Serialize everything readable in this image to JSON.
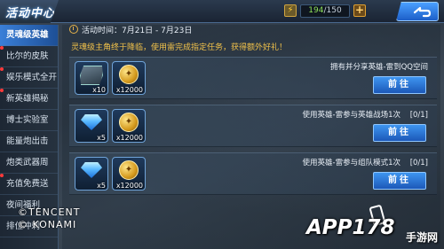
{
  "header": {
    "title": "活动中心",
    "stamina_current": "194",
    "stamina_max": "/150",
    "plus_label": "+",
    "stamina_icon": "lightning-icon",
    "back_icon": "return-arrow-icon"
  },
  "sidebar": {
    "items": [
      {
        "label": "灵魂级英雄",
        "active": true
      },
      {
        "label": "比尔的皮肤",
        "active": false
      },
      {
        "label": "娱乐模式全开",
        "active": false
      },
      {
        "label": "新英雄揭秘",
        "active": false
      },
      {
        "label": "博士实验室",
        "active": false
      },
      {
        "label": "能量炮出击",
        "active": false
      },
      {
        "label": "炮类武器周",
        "active": false
      },
      {
        "label": "充值免费送",
        "active": false
      },
      {
        "label": "夜间福利",
        "active": false
      },
      {
        "label": "排位冲刺",
        "active": false
      }
    ]
  },
  "activity": {
    "time_label": "活动时间：7月21日 - 7月23日",
    "description": "灵魂级主角终于降临，使用雷完成指定任务，获得额外好礼！"
  },
  "tasks": [
    {
      "text": "拥有并分享英雄-雷到QQ空间",
      "progress": "",
      "button": "前往",
      "rewards": [
        {
          "icon": "emblem-icon",
          "qty": "x10"
        },
        {
          "icon": "gold-coin-icon",
          "qty": "x12000"
        }
      ]
    },
    {
      "text": "使用英雄-雷参与英雄战场1次",
      "progress": "[0/1]",
      "button": "前往",
      "rewards": [
        {
          "icon": "diamond-icon",
          "qty": "x5"
        },
        {
          "icon": "gold-coin-icon",
          "qty": "x12000"
        }
      ]
    },
    {
      "text": "使用英雄-雷参与组队模式1次",
      "progress": "[0/1]",
      "button": "前往",
      "rewards": [
        {
          "icon": "diamond-icon",
          "qty": "x5"
        },
        {
          "icon": "gold-coin-icon",
          "qty": "x12000"
        }
      ]
    }
  ],
  "copyright": {
    "line1": "©TENCENT",
    "line2": "© KONAMI"
  },
  "watermark": {
    "brand": "APP178",
    "sub": "手游网"
  },
  "colors": {
    "accent_blue": "#3e95f0",
    "highlight_gold": "#f2c24a",
    "active_tab": "#3a7fd8"
  }
}
